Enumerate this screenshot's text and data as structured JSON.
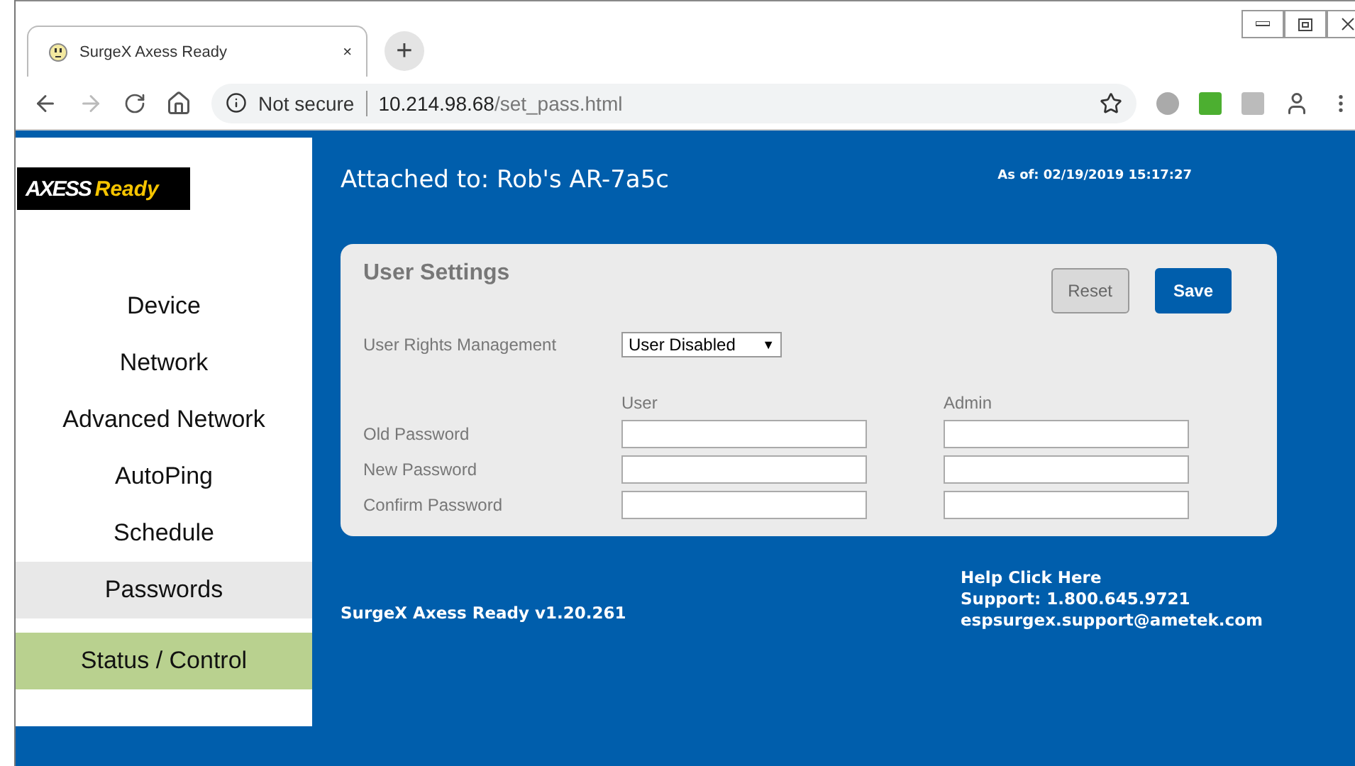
{
  "browser": {
    "tab_title": "SurgeX Axess Ready",
    "tab_close": "×",
    "new_tab": "+",
    "security": "Not secure",
    "url_host": "10.214.98.68",
    "url_path": "/set_pass.html"
  },
  "logo": {
    "part_1": "AXESS",
    "part_2": "Ready"
  },
  "sidebar": {
    "items": [
      {
        "label": "Device",
        "selected": false,
        "kind": "link"
      },
      {
        "label": "Network",
        "selected": false,
        "kind": "link"
      },
      {
        "label": "Advanced Network",
        "selected": false,
        "kind": "link"
      },
      {
        "label": "AutoPing",
        "selected": false,
        "kind": "link"
      },
      {
        "label": "Schedule",
        "selected": false,
        "kind": "link"
      },
      {
        "label": "Passwords",
        "selected": true,
        "kind": "link"
      },
      {
        "label": "Status / Control",
        "selected": false,
        "kind": "action"
      }
    ]
  },
  "header": {
    "attached": "Attached to: Rob's AR-7a5c",
    "as_of": "As of: 02/19/2019 15:17:27"
  },
  "panel": {
    "title": "User Settings",
    "buttons": [
      {
        "label": "Reset",
        "kind": "secondary"
      },
      {
        "label": "Save",
        "kind": "primary"
      }
    ],
    "rights_label": "User Rights Management",
    "rights_value": "User Disabled",
    "rights_caret": "▼",
    "columns": [
      "User",
      "Admin"
    ],
    "rows": [
      "Old Password",
      "New Password",
      "Confirm Password"
    ]
  },
  "footer": {
    "version": "SurgeX Axess Ready v1.20.261",
    "help": "Help Click Here",
    "support": "Support: 1.800.645.9721",
    "email": "espsurgex.support@ametek.com"
  }
}
